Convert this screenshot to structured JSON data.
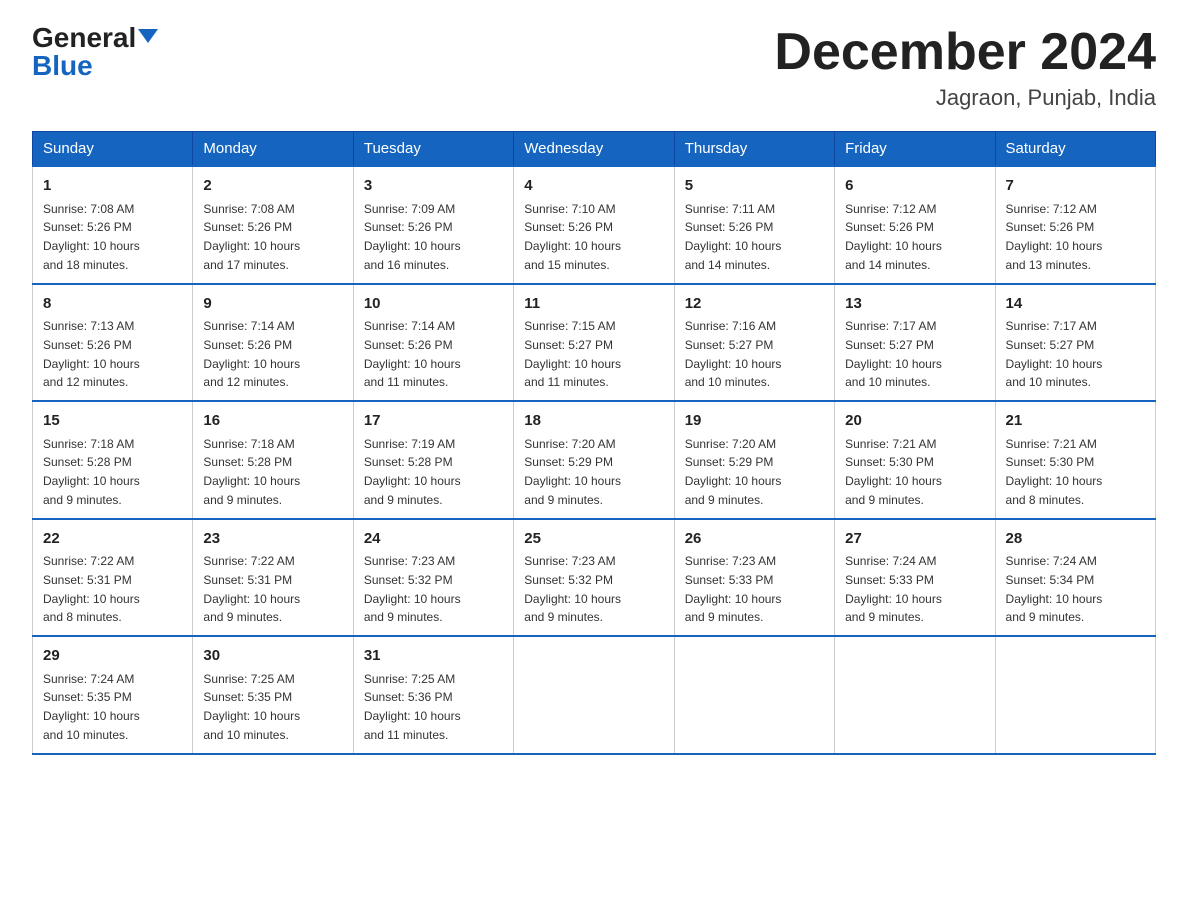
{
  "header": {
    "logo": {
      "general": "General",
      "blue": "Blue"
    },
    "title": "December 2024",
    "location": "Jagraon, Punjab, India"
  },
  "calendar": {
    "days_of_week": [
      "Sunday",
      "Monday",
      "Tuesday",
      "Wednesday",
      "Thursday",
      "Friday",
      "Saturday"
    ],
    "weeks": [
      [
        {
          "day": "1",
          "sunrise": "7:08 AM",
          "sunset": "5:26 PM",
          "daylight": "10 hours and 18 minutes."
        },
        {
          "day": "2",
          "sunrise": "7:08 AM",
          "sunset": "5:26 PM",
          "daylight": "10 hours and 17 minutes."
        },
        {
          "day": "3",
          "sunrise": "7:09 AM",
          "sunset": "5:26 PM",
          "daylight": "10 hours and 16 minutes."
        },
        {
          "day": "4",
          "sunrise": "7:10 AM",
          "sunset": "5:26 PM",
          "daylight": "10 hours and 15 minutes."
        },
        {
          "day": "5",
          "sunrise": "7:11 AM",
          "sunset": "5:26 PM",
          "daylight": "10 hours and 14 minutes."
        },
        {
          "day": "6",
          "sunrise": "7:12 AM",
          "sunset": "5:26 PM",
          "daylight": "10 hours and 14 minutes."
        },
        {
          "day": "7",
          "sunrise": "7:12 AM",
          "sunset": "5:26 PM",
          "daylight": "10 hours and 13 minutes."
        }
      ],
      [
        {
          "day": "8",
          "sunrise": "7:13 AM",
          "sunset": "5:26 PM",
          "daylight": "10 hours and 12 minutes."
        },
        {
          "day": "9",
          "sunrise": "7:14 AM",
          "sunset": "5:26 PM",
          "daylight": "10 hours and 12 minutes."
        },
        {
          "day": "10",
          "sunrise": "7:14 AM",
          "sunset": "5:26 PM",
          "daylight": "10 hours and 11 minutes."
        },
        {
          "day": "11",
          "sunrise": "7:15 AM",
          "sunset": "5:27 PM",
          "daylight": "10 hours and 11 minutes."
        },
        {
          "day": "12",
          "sunrise": "7:16 AM",
          "sunset": "5:27 PM",
          "daylight": "10 hours and 10 minutes."
        },
        {
          "day": "13",
          "sunrise": "7:17 AM",
          "sunset": "5:27 PM",
          "daylight": "10 hours and 10 minutes."
        },
        {
          "day": "14",
          "sunrise": "7:17 AM",
          "sunset": "5:27 PM",
          "daylight": "10 hours and 10 minutes."
        }
      ],
      [
        {
          "day": "15",
          "sunrise": "7:18 AM",
          "sunset": "5:28 PM",
          "daylight": "10 hours and 9 minutes."
        },
        {
          "day": "16",
          "sunrise": "7:18 AM",
          "sunset": "5:28 PM",
          "daylight": "10 hours and 9 minutes."
        },
        {
          "day": "17",
          "sunrise": "7:19 AM",
          "sunset": "5:28 PM",
          "daylight": "10 hours and 9 minutes."
        },
        {
          "day": "18",
          "sunrise": "7:20 AM",
          "sunset": "5:29 PM",
          "daylight": "10 hours and 9 minutes."
        },
        {
          "day": "19",
          "sunrise": "7:20 AM",
          "sunset": "5:29 PM",
          "daylight": "10 hours and 9 minutes."
        },
        {
          "day": "20",
          "sunrise": "7:21 AM",
          "sunset": "5:30 PM",
          "daylight": "10 hours and 9 minutes."
        },
        {
          "day": "21",
          "sunrise": "7:21 AM",
          "sunset": "5:30 PM",
          "daylight": "10 hours and 8 minutes."
        }
      ],
      [
        {
          "day": "22",
          "sunrise": "7:22 AM",
          "sunset": "5:31 PM",
          "daylight": "10 hours and 8 minutes."
        },
        {
          "day": "23",
          "sunrise": "7:22 AM",
          "sunset": "5:31 PM",
          "daylight": "10 hours and 9 minutes."
        },
        {
          "day": "24",
          "sunrise": "7:23 AM",
          "sunset": "5:32 PM",
          "daylight": "10 hours and 9 minutes."
        },
        {
          "day": "25",
          "sunrise": "7:23 AM",
          "sunset": "5:32 PM",
          "daylight": "10 hours and 9 minutes."
        },
        {
          "day": "26",
          "sunrise": "7:23 AM",
          "sunset": "5:33 PM",
          "daylight": "10 hours and 9 minutes."
        },
        {
          "day": "27",
          "sunrise": "7:24 AM",
          "sunset": "5:33 PM",
          "daylight": "10 hours and 9 minutes."
        },
        {
          "day": "28",
          "sunrise": "7:24 AM",
          "sunset": "5:34 PM",
          "daylight": "10 hours and 9 minutes."
        }
      ],
      [
        {
          "day": "29",
          "sunrise": "7:24 AM",
          "sunset": "5:35 PM",
          "daylight": "10 hours and 10 minutes."
        },
        {
          "day": "30",
          "sunrise": "7:25 AM",
          "sunset": "5:35 PM",
          "daylight": "10 hours and 10 minutes."
        },
        {
          "day": "31",
          "sunrise": "7:25 AM",
          "sunset": "5:36 PM",
          "daylight": "10 hours and 11 minutes."
        },
        null,
        null,
        null,
        null
      ]
    ],
    "labels": {
      "sunrise": "Sunrise:",
      "sunset": "Sunset:",
      "daylight": "Daylight:"
    }
  }
}
